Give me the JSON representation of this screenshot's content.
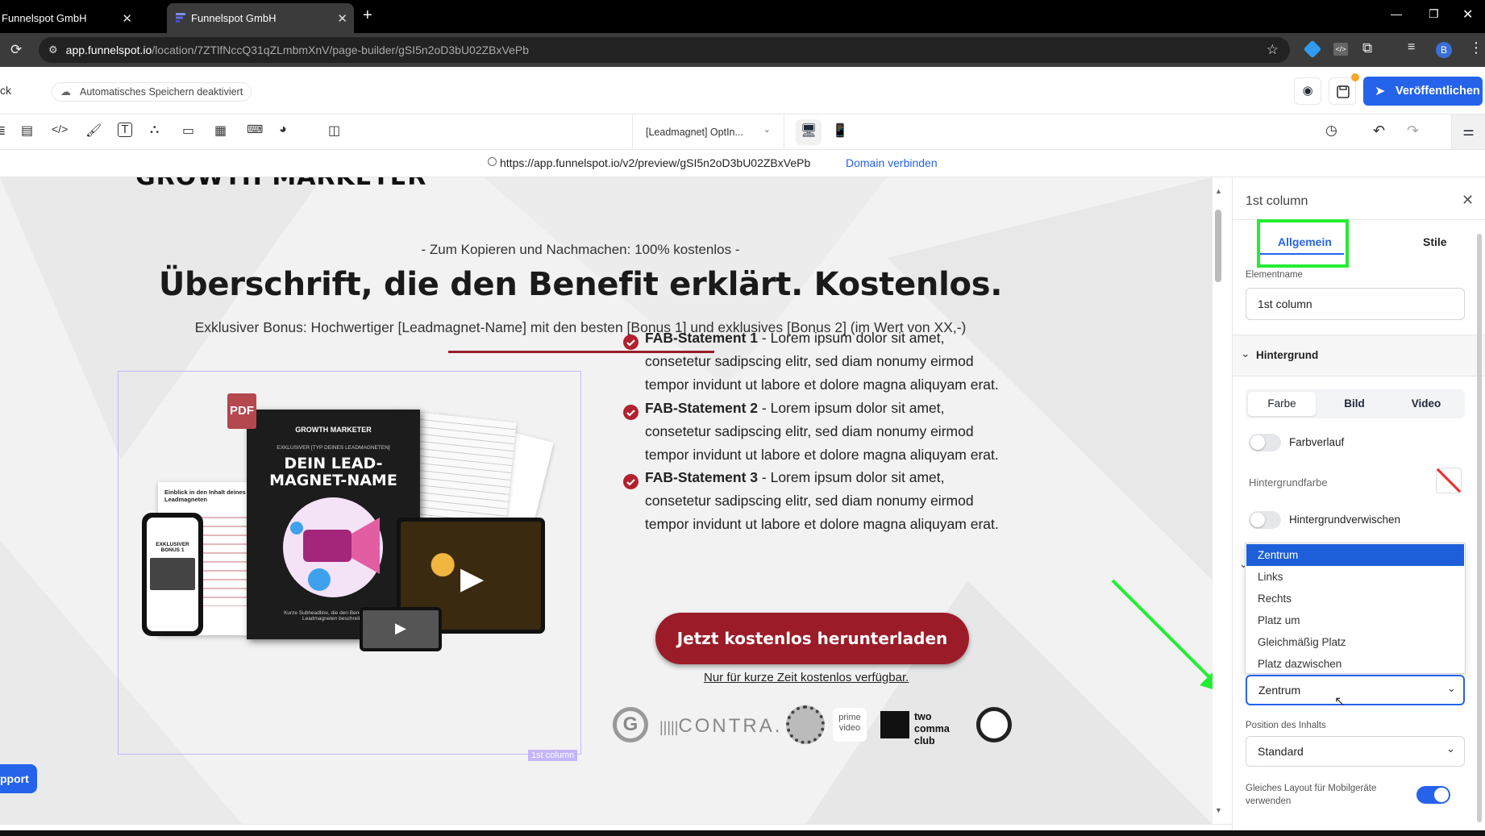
{
  "browser": {
    "tabs": [
      {
        "title": "Funnelspot GmbH"
      },
      {
        "title": "Funnelspot GmbH"
      }
    ],
    "url_host": "app.funnelspot.io",
    "url_path": "/location/7ZTlfNccQ31qZLmbmXnV/page-builder/gSI5n2oD3bU02ZBxVePb",
    "profile_initial": "B"
  },
  "builder": {
    "back_label": "ck",
    "autosave_label": "Automatisches Speichern deaktiviert",
    "publish_label": "Veröffentlichen",
    "page_select": "[Leadmagnet] OptIn...",
    "preview_url": "https://app.funnelspot.io/v2/preview/gSI5n2oD3bU02ZBxVePb",
    "domain_link": "Domain verbinden",
    "support_label": "pport"
  },
  "page": {
    "logo_text": "GROWTH MARKETER",
    "pre_headline": "- Zum Kopieren und Nachmachen: 100% kostenlos -",
    "headline": "Überschrift, die den Benefit erklärt. Kostenlos.",
    "subheadline": "Exklusiver Bonus: Hochwertiger [Leadmagnet-Name] mit den besten [Bonus 1] und exklusives [Bonus 2] (im Wert von XX,-)",
    "statements": [
      {
        "title": "FAB-Statement 1",
        "line1": " - Lorem ipsum dolor sit amet,",
        "line2": "consetetur sadipscing elitr, sed diam nonumy eirmod",
        "line3": "tempor invidunt ut labore et dolore magna aliquyam erat."
      },
      {
        "title": "FAB-Statement 2",
        "line1": " - Lorem ipsum dolor sit amet,",
        "line2": "consetetur sadipscing elitr, sed diam nonumy eirmod",
        "line3": "tempor invidunt ut labore et dolore magna aliquyam erat."
      },
      {
        "title": "FAB-Statement 3",
        "line1": " - Lorem ipsum dolor sit amet,",
        "line2": "consetetur sadipscing elitr, sed diam nonumy eirmod",
        "line3": "tempor invidunt ut labore et dolore magna aliquyam erat."
      }
    ],
    "cta_label": "Jetzt kostenlos herunterladen",
    "cta_note": "Nur für kurze Zeit kostenlos verfügbar.",
    "column_tag": "1st column",
    "mockup": {
      "pdf_badge": "PDF",
      "book_brand": "GROWTH MARKETER",
      "book_kicker": "EXKLUSIVER [TYP DEINES LEADMAGNETEN]",
      "book_title_1": "DEIN LEAD-",
      "book_title_2": "MAGNET-NAME",
      "book_footer": "Kurze Subheadline, die den Benefit deines Leadmagneten beschreibt.",
      "doc_title": "Einblick in den Inhalt deines Leadmagneten",
      "phone_title": "EXKLUSIVER BONUS 1"
    },
    "logos": [
      "G",
      "CONTRA.",
      "prime video",
      "two comma club"
    ]
  },
  "panel": {
    "title": "1st column",
    "tabs": [
      "Allgemein",
      "Stile"
    ],
    "element_name_label": "Elementname",
    "element_name_value": "1st column",
    "section_background": "Hintergrund",
    "bg_tabs": [
      "Farbe",
      "Bild",
      "Video"
    ],
    "gradient_label": "Farbverlauf",
    "bg_color_label": "Hintergrundfarbe",
    "blur_label": "Hintergrundverwischen",
    "dropdown_options": [
      "Zentrum",
      "Links",
      "Rechts",
      "Platz um",
      "Gleichmäßig Platz",
      "Platz dazwischen"
    ],
    "dropdown_selected": "Zentrum",
    "content_position_label": "Position des Inhalts",
    "content_position_value": "Standard",
    "mobile_layout_label": "Gleiches Layout für Mobilgeräte verwenden"
  },
  "colors": {
    "accent_blue": "#2563eb",
    "brand_red": "#9b1c28",
    "highlight_green": "#22ee33",
    "selection_purple": "#c4b5fd"
  }
}
